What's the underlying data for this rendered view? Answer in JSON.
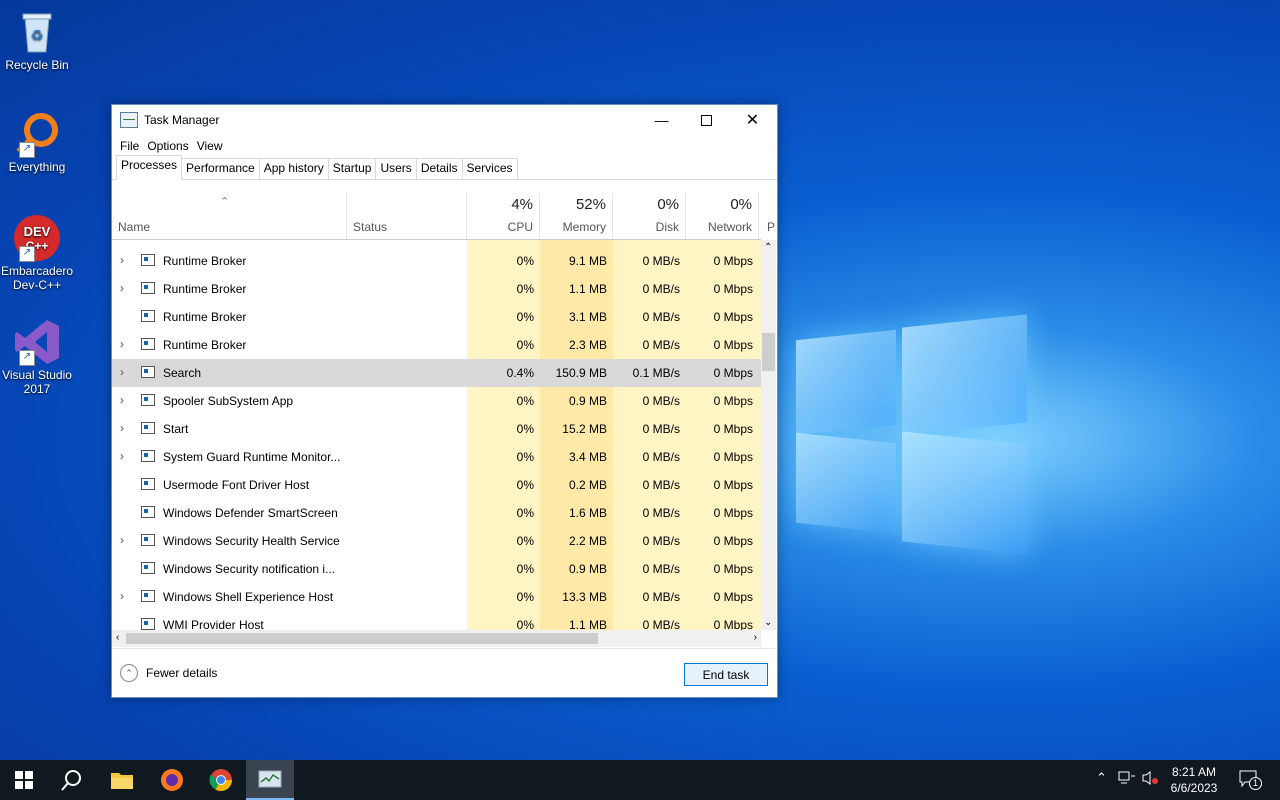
{
  "desktop": {
    "icons": [
      {
        "label": "Recycle Bin"
      },
      {
        "label": "Everything"
      },
      {
        "label": "Embarcadero Dev-C++"
      },
      {
        "label": "Visual Studio 2017"
      }
    ]
  },
  "window": {
    "title": "Task Manager",
    "menu": [
      "File",
      "Options",
      "View"
    ],
    "tabs": [
      "Processes",
      "Performance",
      "App history",
      "Startup",
      "Users",
      "Details",
      "Services"
    ],
    "active_tab": "Processes"
  },
  "columns": {
    "name": "Name",
    "status": "Status",
    "cpu": {
      "pct": "4%",
      "label": "CPU"
    },
    "memory": {
      "pct": "52%",
      "label": "Memory"
    },
    "disk": {
      "pct": "0%",
      "label": "Disk"
    },
    "network": {
      "pct": "0%",
      "label": "Network"
    },
    "power": "P"
  },
  "processes": [
    {
      "name": "Runtime Broker",
      "expand": true,
      "cpu": "0%",
      "memory": "9.1 MB",
      "disk": "0 MB/s",
      "network": "0 Mbps"
    },
    {
      "name": "Runtime Broker",
      "expand": true,
      "cpu": "0%",
      "memory": "1.1 MB",
      "disk": "0 MB/s",
      "network": "0 Mbps"
    },
    {
      "name": "Runtime Broker",
      "expand": false,
      "cpu": "0%",
      "memory": "3.1 MB",
      "disk": "0 MB/s",
      "network": "0 Mbps"
    },
    {
      "name": "Runtime Broker",
      "expand": true,
      "cpu": "0%",
      "memory": "2.3 MB",
      "disk": "0 MB/s",
      "network": "0 Mbps"
    },
    {
      "name": "Search",
      "expand": true,
      "selected": true,
      "cpu": "0.4%",
      "memory": "150.9 MB",
      "disk": "0.1 MB/s",
      "network": "0 Mbps"
    },
    {
      "name": "Spooler SubSystem App",
      "expand": true,
      "cpu": "0%",
      "memory": "0.9 MB",
      "disk": "0 MB/s",
      "network": "0 Mbps"
    },
    {
      "name": "Start",
      "expand": true,
      "cpu": "0%",
      "memory": "15.2 MB",
      "disk": "0 MB/s",
      "network": "0 Mbps"
    },
    {
      "name": "System Guard Runtime Monitor...",
      "expand": true,
      "cpu": "0%",
      "memory": "3.4 MB",
      "disk": "0 MB/s",
      "network": "0 Mbps"
    },
    {
      "name": "Usermode Font Driver Host",
      "expand": false,
      "cpu": "0%",
      "memory": "0.2 MB",
      "disk": "0 MB/s",
      "network": "0 Mbps"
    },
    {
      "name": "Windows Defender SmartScreen",
      "expand": false,
      "cpu": "0%",
      "memory": "1.6 MB",
      "disk": "0 MB/s",
      "network": "0 Mbps"
    },
    {
      "name": "Windows Security Health Service",
      "expand": true,
      "cpu": "0%",
      "memory": "2.2 MB",
      "disk": "0 MB/s",
      "network": "0 Mbps"
    },
    {
      "name": "Windows Security notification i...",
      "expand": false,
      "cpu": "0%",
      "memory": "0.9 MB",
      "disk": "0 MB/s",
      "network": "0 Mbps"
    },
    {
      "name": "Windows Shell Experience Host",
      "expand": true,
      "cpu": "0%",
      "memory": "13.3 MB",
      "disk": "0 MB/s",
      "network": "0 Mbps"
    },
    {
      "name": "WMI Provider Host",
      "expand": false,
      "cpu": "0%",
      "memory": "1.1 MB",
      "disk": "0 MB/s",
      "network": "0 Mbps"
    }
  ],
  "footer": {
    "fewer_details": "Fewer details",
    "end_task": "End task"
  },
  "taskbar": {
    "time": "8:21 AM",
    "date": "6/6/2023",
    "notification_count": "1"
  },
  "colors": {
    "cpu_col": "#fff4c4",
    "memory_col": "#ffe9a8",
    "disk_col": "#fff4c4",
    "network_col": "#fff4c4"
  }
}
